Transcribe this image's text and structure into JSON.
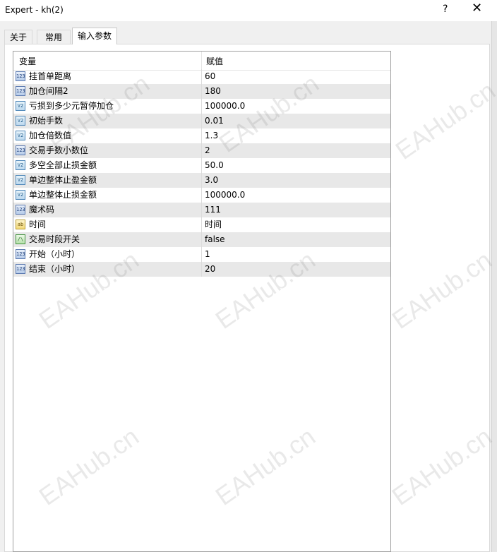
{
  "window": {
    "title": "Expert - kh(2)",
    "help": "?",
    "close": "✕"
  },
  "tabs": [
    {
      "label": "关于"
    },
    {
      "label": "常用"
    },
    {
      "label": "输入参数"
    }
  ],
  "grid": {
    "headers": {
      "variable": "变量",
      "value": "赋值"
    },
    "rows": [
      {
        "icon": "int",
        "icon_text": "123",
        "name": "挂首单距离",
        "value": "60"
      },
      {
        "icon": "int",
        "icon_text": "123",
        "name": "加仓间隔2",
        "value": "180"
      },
      {
        "icon": "dbl",
        "icon_text": "V2",
        "name": "亏损到多少元暂停加仓",
        "value": "100000.0"
      },
      {
        "icon": "dbl",
        "icon_text": "V2",
        "name": "初始手数",
        "value": "0.01"
      },
      {
        "icon": "dbl",
        "icon_text": "V2",
        "name": "加仓倍数值",
        "value": "1.3"
      },
      {
        "icon": "int",
        "icon_text": "123",
        "name": "交易手数小数位",
        "value": "2"
      },
      {
        "icon": "dbl",
        "icon_text": "V2",
        "name": "多空全部止损金额",
        "value": "50.0"
      },
      {
        "icon": "dbl",
        "icon_text": "V2",
        "name": "单边整体止盈金额",
        "value": "3.0"
      },
      {
        "icon": "dbl",
        "icon_text": "V2",
        "name": "单边整体止损金额",
        "value": "100000.0"
      },
      {
        "icon": "int",
        "icon_text": "123",
        "name": "魔术码",
        "value": "111"
      },
      {
        "icon": "str",
        "icon_text": "ab",
        "name": "时间",
        "value": "时间"
      },
      {
        "icon": "bool",
        "icon_text": "/\\",
        "name": "交易时段开关",
        "value": "false"
      },
      {
        "icon": "int",
        "icon_text": "123",
        "name": "开始（小时）",
        "value": "1"
      },
      {
        "icon": "int",
        "icon_text": "123",
        "name": "结束（小时）",
        "value": "20"
      }
    ]
  },
  "watermark": {
    "text": "EAHub.cn"
  }
}
